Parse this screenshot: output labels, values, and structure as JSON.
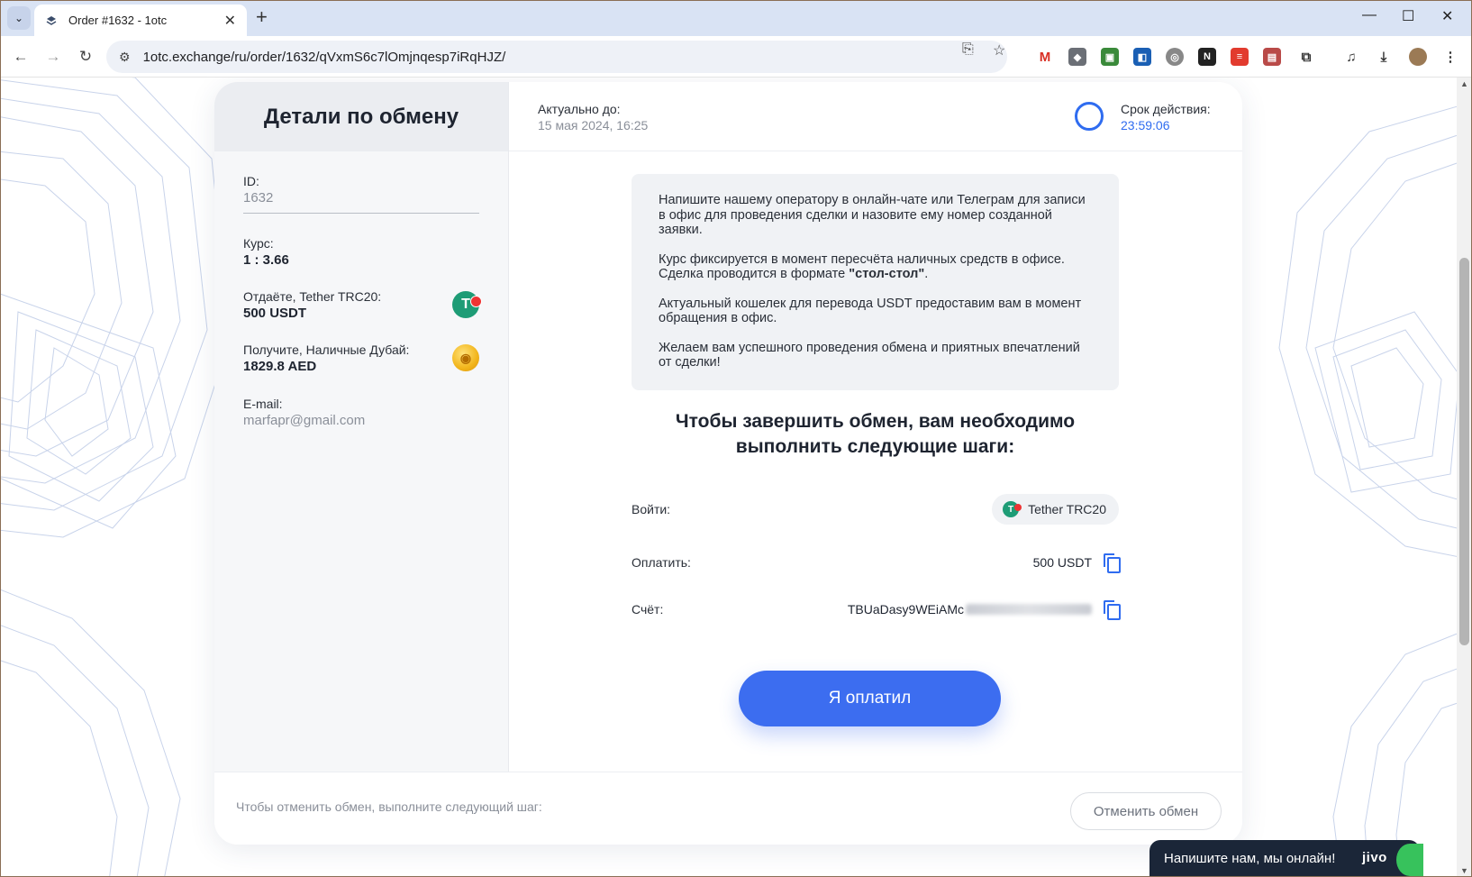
{
  "browser": {
    "tab_title": "Order #1632 - 1otc",
    "url": "1otc.exchange/ru/order/1632/qVxmS6c7lOmjnqesp7iRqHJZ/",
    "extensions": [
      "gmail-icon",
      "extension-icon",
      "extension-icon",
      "extension-icon",
      "extension-icon",
      "notion-icon",
      "extension-icon",
      "extension-icon",
      "puzzle-icon",
      "media-icon",
      "download-icon",
      "avatar"
    ]
  },
  "left_panel": {
    "title": "Детали по обмену",
    "id_label": "ID:",
    "id_value": "1632",
    "rate_label": "Курс:",
    "rate_value": "1 : 3.66",
    "give_label": "Отдаёте, Tether TRC20:",
    "give_value": "500 USDT",
    "get_label": "Получите, Наличные Дубай:",
    "get_value": "1829.8 AED",
    "email_label": "E-mail:",
    "email_value": "marfapr@gmail.com"
  },
  "header": {
    "actual_label": "Актуально до:",
    "actual_value": "15 мая 2024, 16:25",
    "timer_label": "Срок действия:",
    "timer_value": "23:59:06"
  },
  "info": {
    "p1": "Напишите нашему оператору в онлайн-чате или Телеграм для записи в офис для проведения сделки и назовите ему номер созданной заявки.",
    "p2_a": "Курс фиксируется в момент пересчёта наличных средств в офисе. Сделка проводится в формате ",
    "p2_b": "\"стол-стол\"",
    "p2_c": ".",
    "p3": "Актуальный кошелек для перевода USDT предоставим вам в момент обращения в офис.",
    "p4": "Желаем вам успешного проведения обмена и приятных впечатлений от сделки!"
  },
  "steps": {
    "title_line1": "Чтобы завершить обмен, вам необходимо",
    "title_line2": "выполнить следующие шаги:",
    "login_label": "Войти:",
    "login_value": "Tether TRC20",
    "pay_label": "Оплатить:",
    "pay_value": "500 USDT",
    "account_label": "Счёт:",
    "account_value": "TBUaDasy9WEiAMc"
  },
  "actions": {
    "paid_button": "Я оплатил",
    "cancel_text": "Чтобы отменить обмен, выполните следующий шаг:",
    "cancel_button": "Отменить обмен"
  },
  "chat": {
    "label": "Напишите нам, мы онлайн!",
    "brand": "jivo"
  },
  "colors": {
    "accent": "#3c6df0",
    "chat_bg": "#1b2638",
    "chat_green": "#37c25c"
  }
}
